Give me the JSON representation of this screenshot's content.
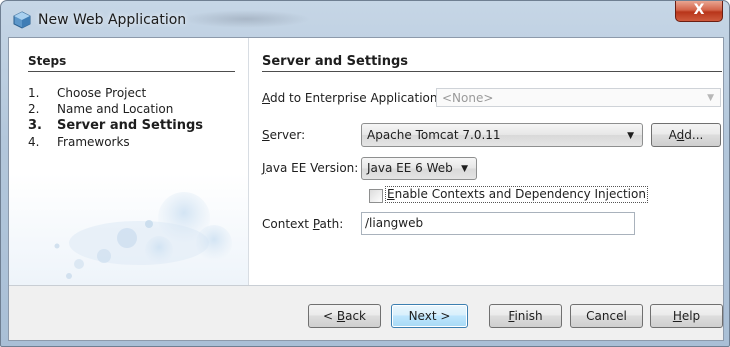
{
  "window": {
    "title": "New Web Application",
    "icon": "netbeans-cube-icon",
    "close_label": "X"
  },
  "steps": {
    "title": "Steps",
    "items": [
      {
        "num": "1.",
        "label": "Choose Project",
        "active": false
      },
      {
        "num": "2.",
        "label": "Name and Location",
        "active": false
      },
      {
        "num": "3.",
        "label": "Server and Settings",
        "active": true
      },
      {
        "num": "4.",
        "label": "Frameworks",
        "active": false
      }
    ]
  },
  "content": {
    "title": "Server and Settings",
    "enterprise_label_m": "A",
    "enterprise_label_r": "dd to Enterprise Application:",
    "enterprise_value": "<None>",
    "server_label_m": "S",
    "server_label_r": "erver:",
    "server_value": "Apache Tomcat 7.0.11",
    "add_label_l": "A",
    "add_label_m": "d",
    "add_label_r": "d...",
    "javaee_label_m": "J",
    "javaee_label_r": "ava EE Version:",
    "javaee_value": "Java EE 6 Web",
    "cdi_label_m": "E",
    "cdi_label_r": "nable Contexts and Dependency Injection",
    "cdi_checked": false,
    "context_label_l": "Context ",
    "context_label_m": "P",
    "context_label_r": "ath:",
    "context_value": "/liangweb"
  },
  "buttons": {
    "back_l": "< ",
    "back_m": "B",
    "back_r": "ack",
    "next": "Next >",
    "finish_m": "F",
    "finish_r": "inish",
    "cancel": "Cancel",
    "help_m": "H",
    "help_r": "elp"
  }
}
